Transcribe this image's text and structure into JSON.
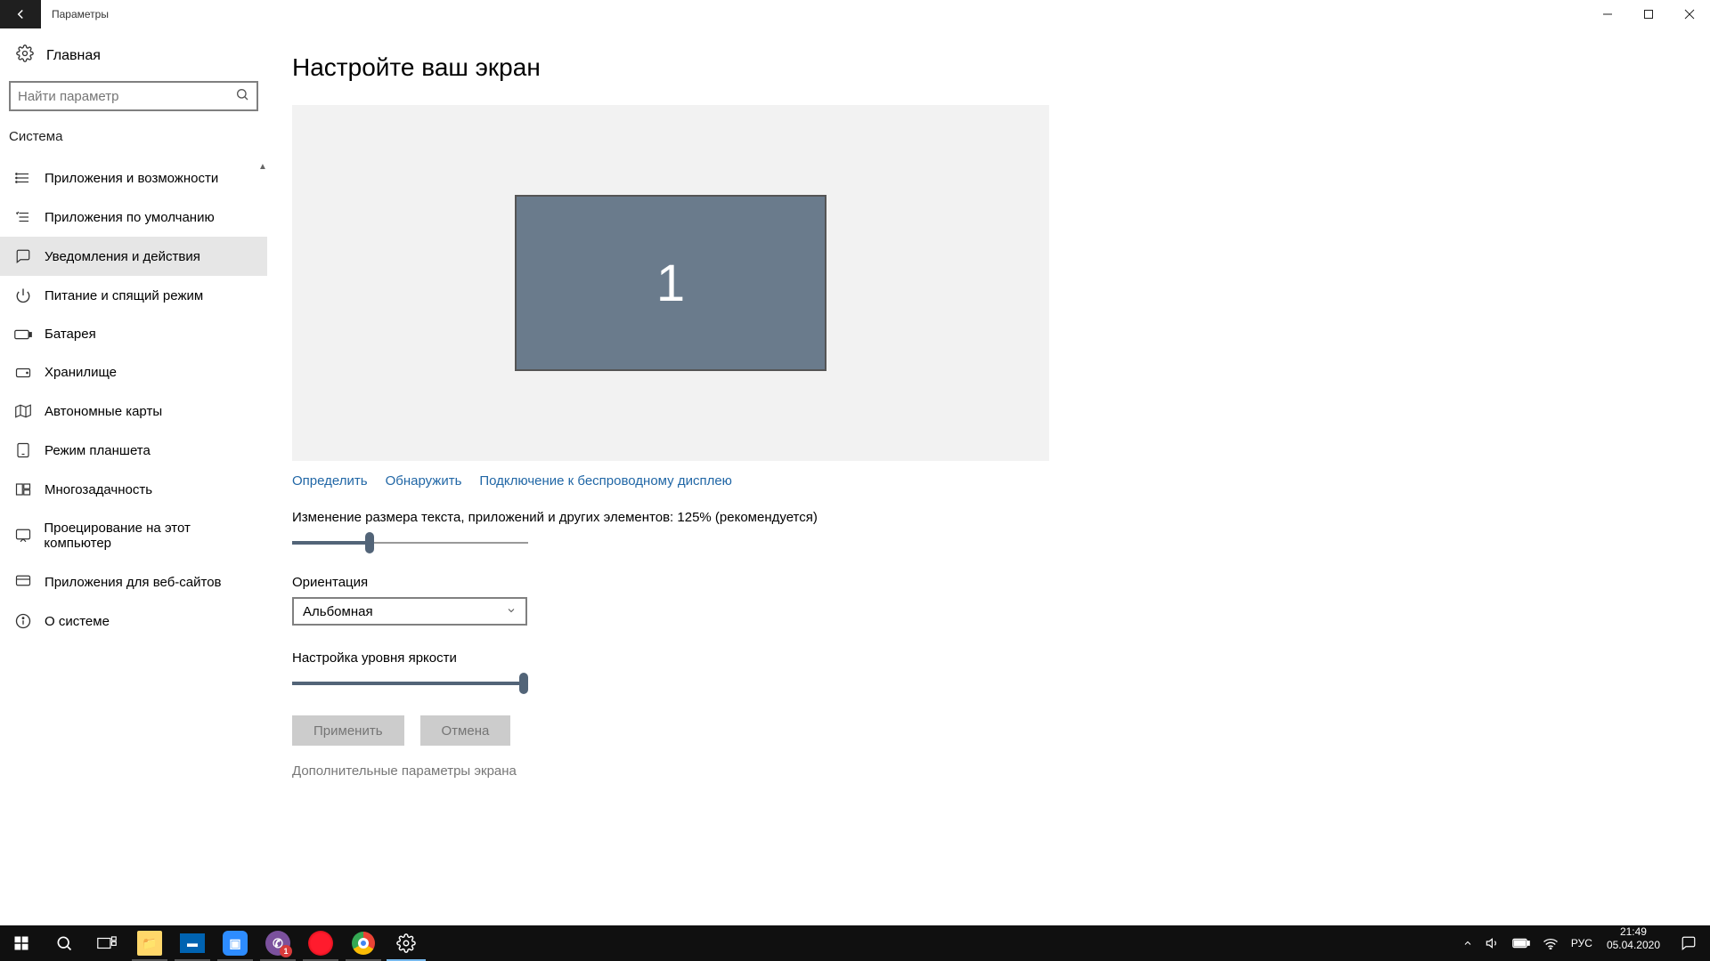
{
  "titlebar": {
    "title": "Параметры"
  },
  "home_label": "Главная",
  "search": {
    "placeholder": "Найти параметр"
  },
  "category": "Система",
  "nav": [
    {
      "icon": "apps",
      "label": "Приложения и возможности"
    },
    {
      "icon": "defaults",
      "label": "Приложения по умолчанию"
    },
    {
      "icon": "notify",
      "label": "Уведомления и действия",
      "selected": true
    },
    {
      "icon": "power",
      "label": "Питание и спящий режим"
    },
    {
      "icon": "battery",
      "label": "Батарея"
    },
    {
      "icon": "storage",
      "label": "Хранилище"
    },
    {
      "icon": "maps",
      "label": "Автономные карты"
    },
    {
      "icon": "tablet",
      "label": "Режим планшета"
    },
    {
      "icon": "multitask",
      "label": "Многозадачность"
    },
    {
      "icon": "project",
      "label": "Проецирование на этот компьютер"
    },
    {
      "icon": "webapps",
      "label": "Приложения для веб-сайтов"
    },
    {
      "icon": "about",
      "label": "О системе"
    }
  ],
  "page": {
    "title": "Настройте ваш экран",
    "display_number": "1",
    "links": {
      "identify": "Определить",
      "detect": "Обнаружить",
      "wireless": "Подключение к беспроводному дисплею"
    },
    "scale_label": "Изменение размера текста, приложений и других элементов: 125% (рекомендуется)",
    "scale_percent": 33,
    "orientation_label": "Ориентация",
    "orientation_value": "Альбомная",
    "brightness_label": "Настройка уровня яркости",
    "brightness_percent": 98,
    "apply": "Применить",
    "cancel": "Отмена",
    "extra": "Дополнительные параметры экрана"
  },
  "taskbar": {
    "viber_badge": "1",
    "lang": "РУС",
    "time": "21:49",
    "date": "05.04.2020"
  }
}
